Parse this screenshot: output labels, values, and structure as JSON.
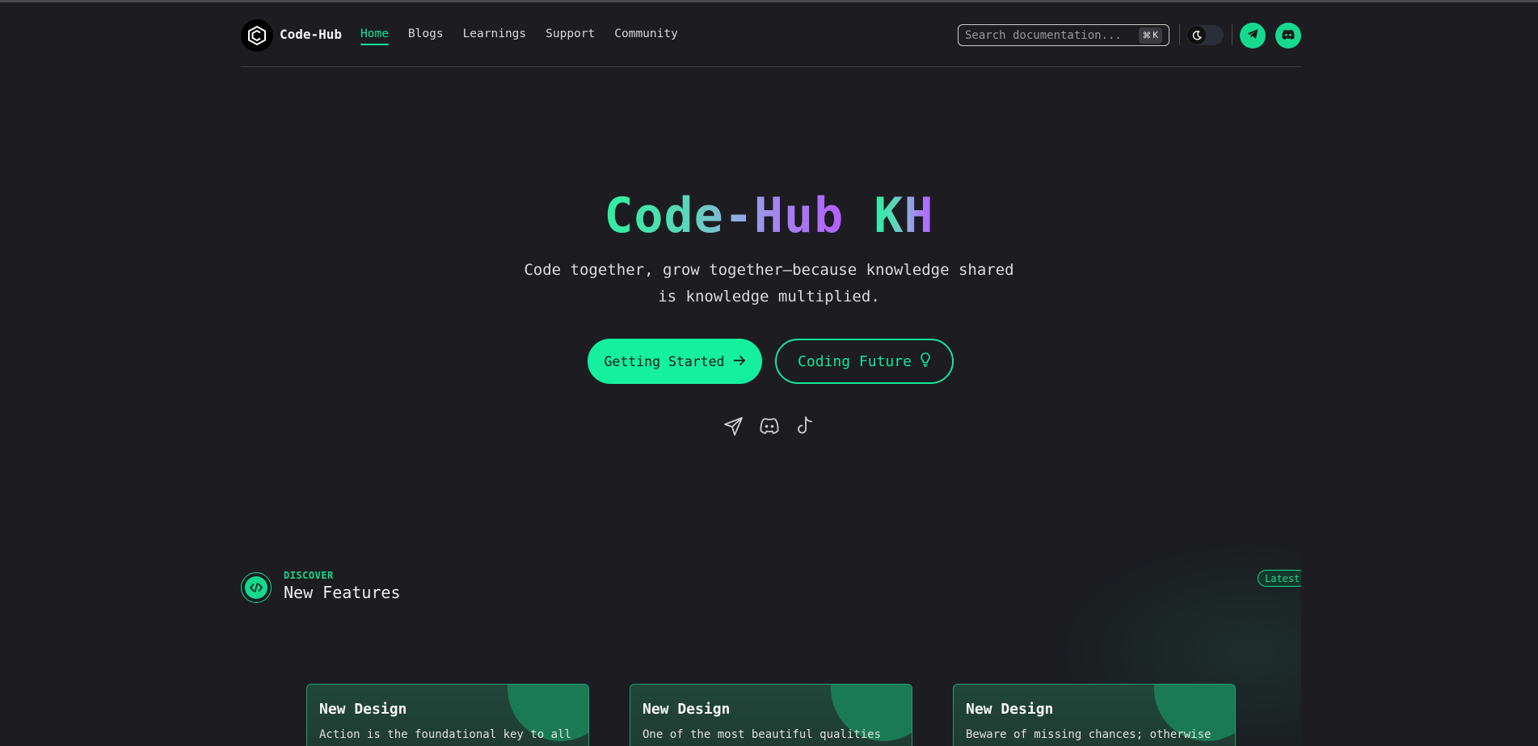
{
  "nav": {
    "brand": "Code-Hub",
    "links": [
      {
        "label": "Home",
        "active": true
      },
      {
        "label": "Blogs",
        "active": false
      },
      {
        "label": "Learnings",
        "active": false
      },
      {
        "label": "Support",
        "active": false
      },
      {
        "label": "Community",
        "active": false
      }
    ],
    "search_placeholder": "Search documentation...",
    "shortcut_symbol": "⌘",
    "shortcut_key": "K",
    "icons": {
      "logo": "code-hub-logo",
      "theme": "moon-icon",
      "telegram": "telegram-icon",
      "discord": "discord-icon"
    }
  },
  "hero": {
    "title_part1": "Code-Hub",
    "title_part2": "KH",
    "subtitle_line1": "Code together, grow together—because knowledge shared",
    "subtitle_line2": "is knowledge multiplied.",
    "primary_button": "Getting Started",
    "secondary_button": "Coding Future",
    "social_icons": [
      "send-icon",
      "discord-icon",
      "tiktok-icon"
    ]
  },
  "section": {
    "kicker": "DISCOVER",
    "title": "New Features",
    "badge": "Latest"
  },
  "cards": [
    {
      "title": "New Design",
      "text": "Action is the foundational key to all"
    },
    {
      "title": "New Design",
      "text": "One of the most beautiful qualities"
    },
    {
      "title": "New Design",
      "text": "Beware of missing chances; otherwise"
    }
  ],
  "colors": {
    "accent": "#14e59a",
    "background": "#1c1c21",
    "title_gradient_start": "#2ef0a0",
    "title_gradient_end": "#b560ff"
  }
}
